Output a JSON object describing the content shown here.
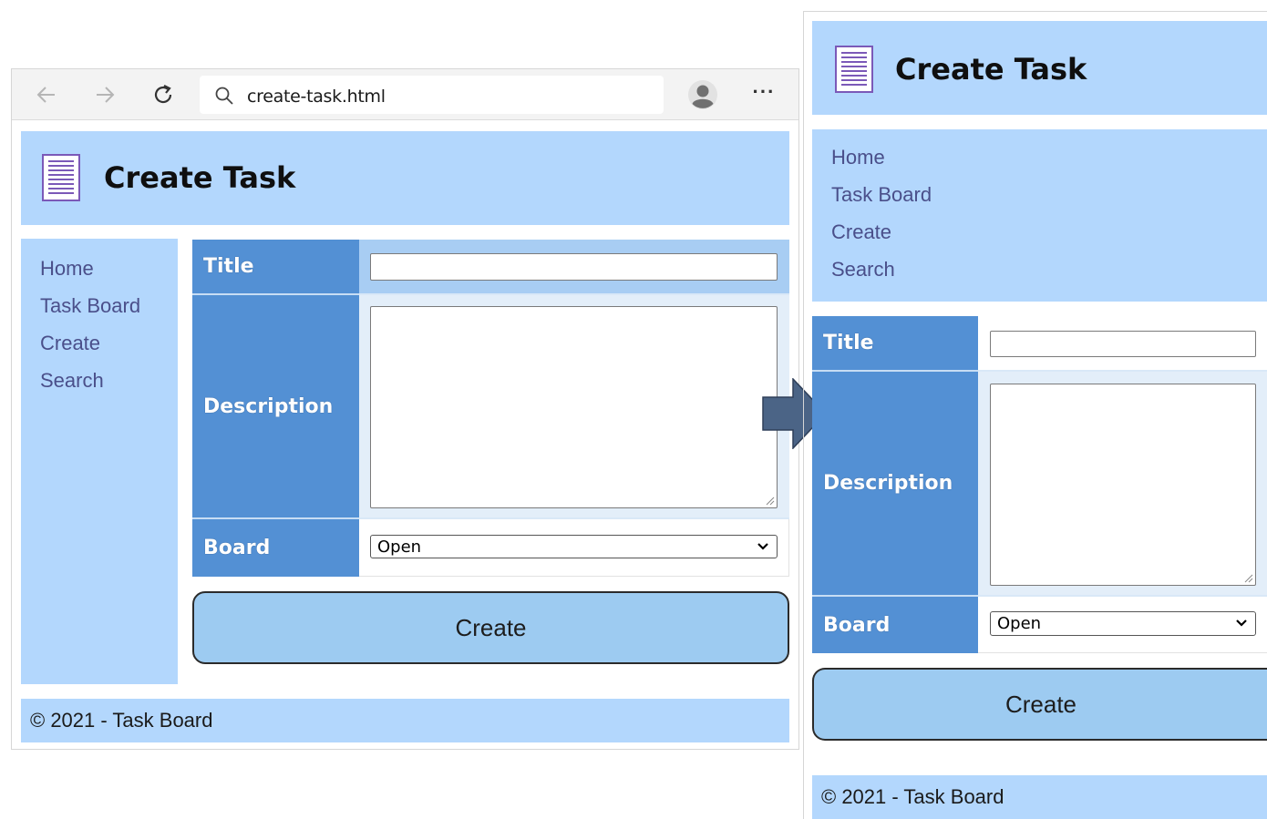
{
  "browser": {
    "url": "create-task.html",
    "icons": {
      "back": "arrow-left-icon",
      "forward": "arrow-right-icon",
      "reload": "reload-icon",
      "search": "search-icon",
      "profile": "profile-icon",
      "more": "more-icon"
    },
    "more_label": "···"
  },
  "page": {
    "title": "Create Task",
    "nav": [
      "Home",
      "Task Board",
      "Create",
      "Search"
    ],
    "form": {
      "title_label": "Title",
      "title_value": "",
      "description_label": "Description",
      "description_value": "",
      "board_label": "Board",
      "board_selected": "Open"
    },
    "create_label": "Create",
    "footer": "© 2021 - Task Board"
  },
  "colors": {
    "panel_bg": "#b3d7fd",
    "label_bg": "#5390d4",
    "button_bg": "#9dcbf1",
    "nav_link": "#4a4f8a",
    "arrow": "#4b6486"
  }
}
